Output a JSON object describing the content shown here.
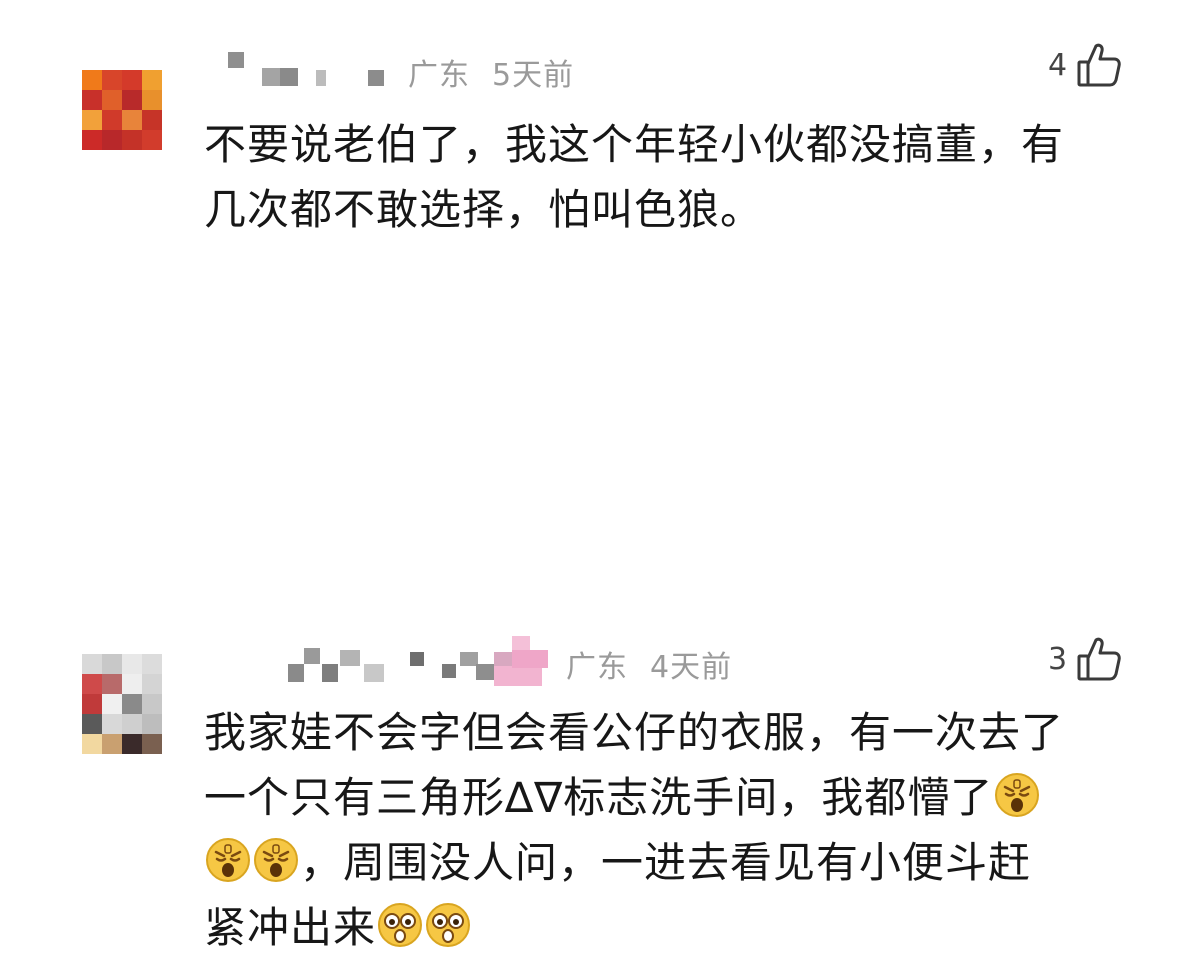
{
  "comments": [
    {
      "location": "广东",
      "time": "5天前",
      "likes": "4",
      "lines": [
        "不要说老伯了，我这个年轻小伙都没搞董，有",
        "几次都不敢选择，怕叫色狼。"
      ]
    },
    {
      "location": "广东",
      "time": "4天前",
      "likes": "3",
      "lines": [
        "我家娃不会字但会看公仔的衣服，有一次去了",
        "一个只有三角形∆∇标志洗手间，我都懵了",
        "，周围没人问，一进去看见有小便斗赶",
        "紧冲出来"
      ]
    }
  ],
  "icons": {
    "like": "thumbs-up-outline-icon",
    "emoji_sleepy": "sleepy-face-emoji-icon",
    "emoji_shocked": "shocked-face-emoji-icon"
  },
  "colors": {
    "meta_text": "#9a9a9a",
    "body_text": "#171717",
    "emoji_face": "#f6c744"
  }
}
